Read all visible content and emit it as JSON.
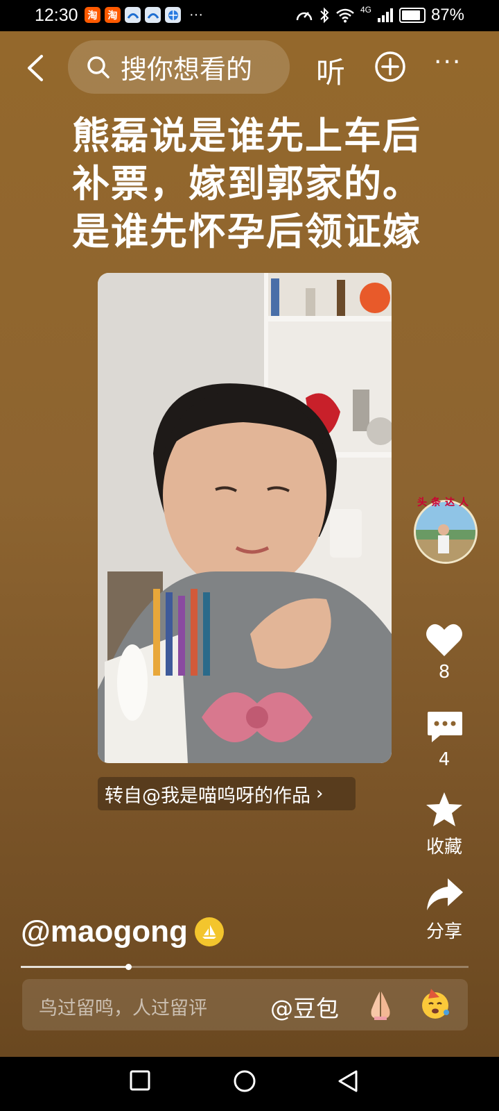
{
  "status_bar": {
    "time": "12:30",
    "app_icons": [
      "taobao-icon",
      "taobao-icon",
      "app-icon",
      "app-icon",
      "browser-icon"
    ],
    "app_glyph": "淘",
    "more": "···",
    "network": "4G",
    "battery_percent": 87,
    "battery_text": "87%"
  },
  "top_bar": {
    "search_placeholder": "搜你想看的",
    "listen_label": "听",
    "more_label": "···"
  },
  "post": {
    "headline_lines": [
      "熊磊说是谁先上车后",
      "补票，嫁到郭家的。",
      "是谁先怀孕后领证嫁"
    ],
    "repost_text": "转自@我是喵呜呀的作品",
    "repost_chevron": "›",
    "author_handle": "@maogong",
    "avatar_badge_text": "头条达人"
  },
  "actions": {
    "like_count": "8",
    "comment_count": "4",
    "favorite_label": "收藏",
    "share_label": "分享"
  },
  "playback": {
    "progress": 0.24
  },
  "comment_bar": {
    "placeholder": "鸟过留鸣，人过留评",
    "mention": "@豆包",
    "emoji_1": "pray-emoji",
    "emoji_2": "party-face-emoji"
  },
  "colors": {
    "background": "#8d6430",
    "accent_badge": "#f3c52d"
  }
}
